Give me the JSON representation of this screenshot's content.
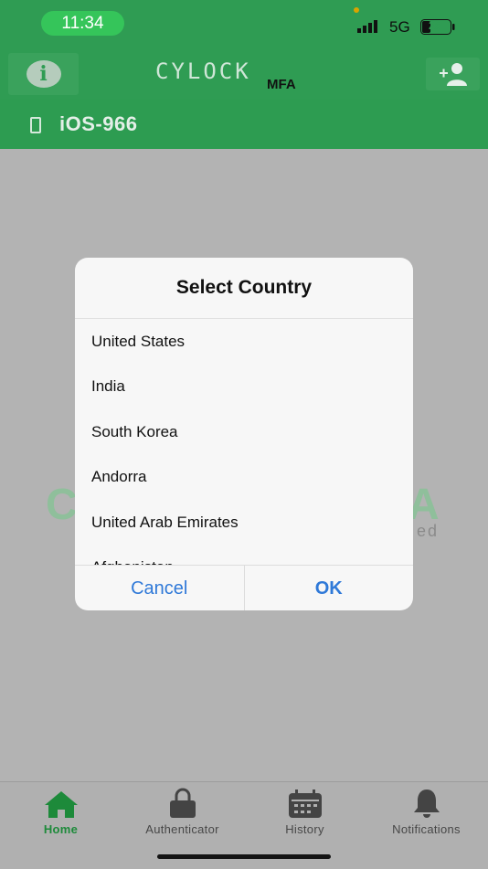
{
  "status_bar": {
    "time": "11:34",
    "network": "5G",
    "battery": "25"
  },
  "header": {
    "logo_text": "CYLOCK",
    "logo_suffix": "MFA",
    "info_icon": "info-icon",
    "add_user_icon": "add-user-icon"
  },
  "device": {
    "icon": "phone-icon",
    "name": "iOS-966"
  },
  "background": {
    "watermark_left": "C",
    "watermark_right": "A",
    "watermark_sub": "ed"
  },
  "dialog": {
    "title": "Select Country",
    "countries": [
      "United States",
      "India",
      "South Korea",
      "Andorra",
      "United Arab Emirates",
      "Afghanistan"
    ],
    "cancel_label": "Cancel",
    "ok_label": "OK"
  },
  "tabs": [
    {
      "label": "Home",
      "icon": "home-icon",
      "active": true
    },
    {
      "label": "Authenticator",
      "icon": "lock-icon",
      "active": false
    },
    {
      "label": "History",
      "icon": "calendar-icon",
      "active": false
    },
    {
      "label": "Notifications",
      "icon": "bell-icon",
      "active": false
    }
  ],
  "colors": {
    "brand_green": "#2f9c53",
    "link_blue": "#2f79d8"
  }
}
